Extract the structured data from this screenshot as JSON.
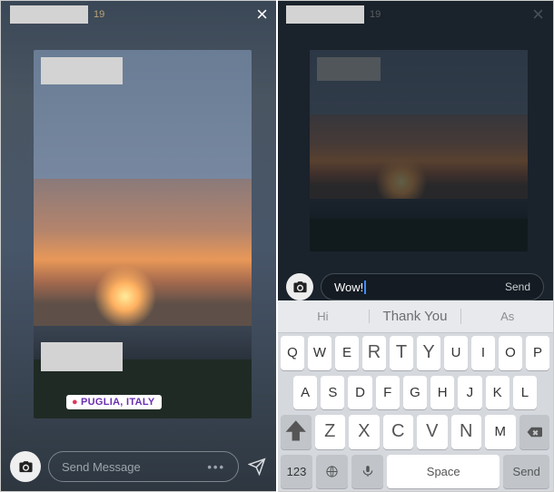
{
  "left": {
    "timestamp": "19",
    "close": "×",
    "geo_tag": "PUGLIA, ITALY",
    "message_placeholder": "Send Message",
    "more": "•••"
  },
  "right": {
    "timestamp": "19",
    "close": "×",
    "typed_text": "Wow!",
    "send_label": "Send"
  },
  "keyboard": {
    "suggestions": [
      "Hi",
      "Thank You",
      "As"
    ],
    "row1": [
      "Q",
      "W",
      "E",
      "R",
      "T",
      "Y",
      "U",
      "I",
      "O",
      "P"
    ],
    "row2": [
      "A",
      "S",
      "D",
      "F",
      "G",
      "H",
      "J",
      "K",
      "L"
    ],
    "row3": [
      "Z",
      "X",
      "C",
      "V",
      "N",
      "M"
    ],
    "fn_123": "123",
    "fn_space": "Space",
    "fn_send": "Send"
  }
}
